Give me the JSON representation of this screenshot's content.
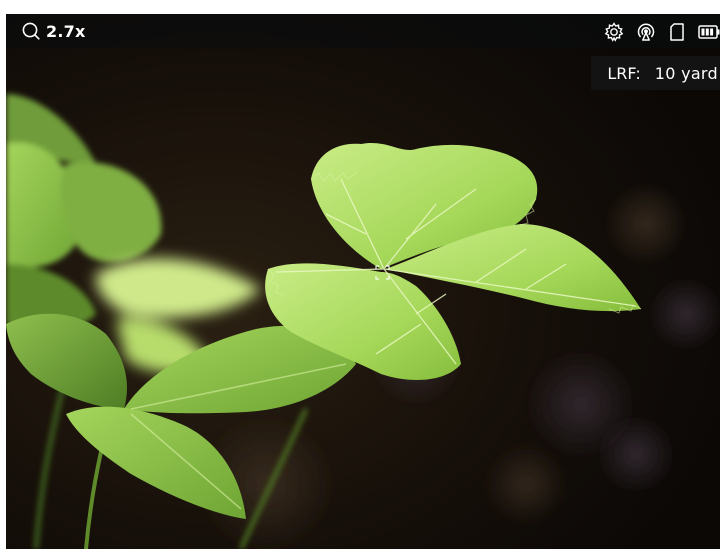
{
  "status_bar": {
    "zoom": "2.7x",
    "icons": [
      "magnifier-icon",
      "settings-gear-icon",
      "hotspot-signal-icon",
      "sd-card-icon",
      "battery-icon"
    ]
  },
  "rangefinder": {
    "label": "LRF:",
    "value": "10 yard"
  },
  "reticle": {
    "icon": "focus-bracket-icon"
  },
  "colors": {
    "overlay": "#0a0c0e",
    "text": "#ffffff",
    "reticle": "#ffffff"
  }
}
